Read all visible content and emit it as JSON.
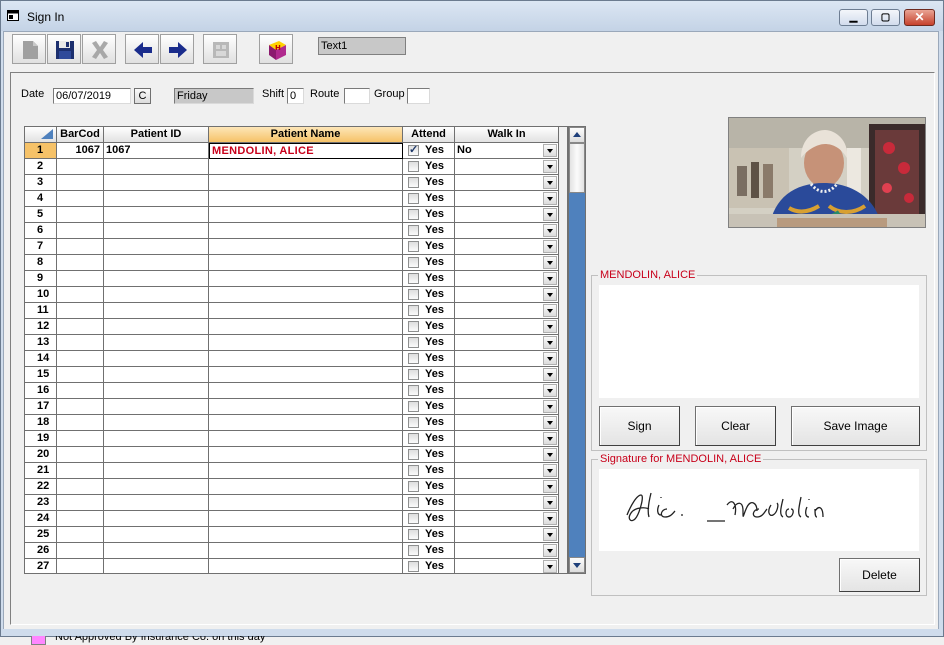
{
  "window": {
    "title": "Sign In"
  },
  "toolbar": {
    "text_field": "Text1"
  },
  "form": {
    "date_label": "Date",
    "date_value": "06/07/2019",
    "c_button": "C",
    "day_value": "Friday",
    "shift_label": "Shift",
    "shift_value": "0",
    "route_label": "Route",
    "route_value": "",
    "group_label": "Group",
    "group_value": ""
  },
  "grid": {
    "headers": [
      "BarCod",
      "Patient ID",
      "Patient Name",
      "Attend",
      "Walk In"
    ],
    "attend_text": "Yes",
    "rows": [
      {
        "n": "1",
        "barcode": "1067",
        "patient_id": "1067",
        "name": "MENDOLIN, ALICE",
        "checked": true,
        "walk_in": "No"
      },
      {
        "n": "2"
      },
      {
        "n": "3"
      },
      {
        "n": "4"
      },
      {
        "n": "5"
      },
      {
        "n": "6"
      },
      {
        "n": "7"
      },
      {
        "n": "8"
      },
      {
        "n": "9"
      },
      {
        "n": "10"
      },
      {
        "n": "11"
      },
      {
        "n": "12"
      },
      {
        "n": "13"
      },
      {
        "n": "14"
      },
      {
        "n": "15"
      },
      {
        "n": "16"
      },
      {
        "n": "17"
      },
      {
        "n": "18"
      },
      {
        "n": "19"
      },
      {
        "n": "20"
      },
      {
        "n": "21"
      },
      {
        "n": "22"
      },
      {
        "n": "23"
      },
      {
        "n": "24"
      },
      {
        "n": "25"
      },
      {
        "n": "26"
      },
      {
        "n": "27"
      }
    ]
  },
  "legend": {
    "text": "Not Approved By Insurance Co. on this day",
    "color": "#ff86ff"
  },
  "sign_panel": {
    "title": "MENDOLIN, ALICE",
    "sign_button": "Sign",
    "clear_button": "Clear",
    "save_button": "Save Image"
  },
  "signature_panel": {
    "title": "Signature for MENDOLIN, ALICE",
    "delete_button": "Delete"
  },
  "colors": {
    "accent_red": "#c8001a",
    "header_highlight": "#f6c268",
    "scroll_blue": "#4f81bd"
  }
}
